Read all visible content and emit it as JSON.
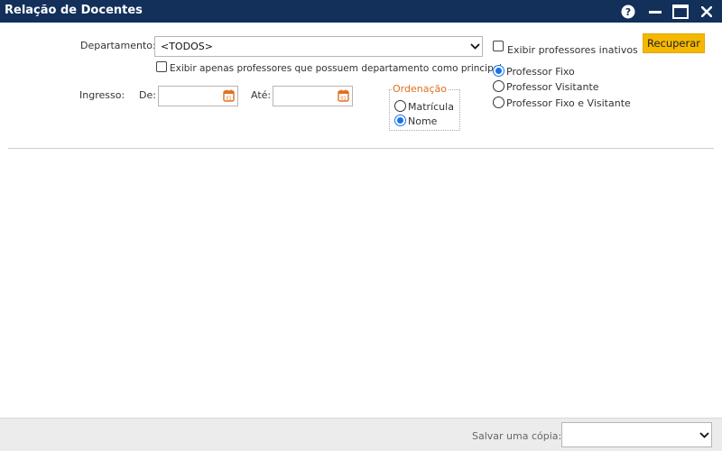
{
  "window": {
    "title": "Relação de Docentes",
    "help_icon": "help-circle-icon",
    "minimize_icon": "minimize-icon",
    "maximize_icon": "maximize-icon",
    "close_icon": "close-icon"
  },
  "filters": {
    "departamento_label": "Departamento:",
    "departamento_value": "<TODOS>",
    "apenas_principal_label": "Exibir apenas professores que possuem departamento como principal",
    "apenas_principal_checked": false,
    "ingresso_label": "Ingresso:",
    "de_label": "De:",
    "de_value": "",
    "ate_label": "Até:",
    "ate_value": "",
    "inativos_label": "Exibir professores inativos",
    "inativos_checked": false
  },
  "ordenacao": {
    "legend": "Ordenação",
    "options": [
      "Matrícula",
      "Nome"
    ],
    "selected": "Nome"
  },
  "tipo_professor": {
    "options": [
      "Professor Fixo",
      "Professor Visitante",
      "Professor Fixo e Visitante"
    ],
    "selected": "Professor Fixo"
  },
  "actions": {
    "recuperar_label": "Recuperar"
  },
  "footer": {
    "salvar_label": "Salvar uma cópia:",
    "salvar_value": ""
  },
  "colors": {
    "titlebar": "#12305a",
    "accent_button": "#f5b800",
    "legend_text": "#e07020",
    "calendar_icon": "#e07020",
    "radio_selected": "#1a73e8"
  }
}
